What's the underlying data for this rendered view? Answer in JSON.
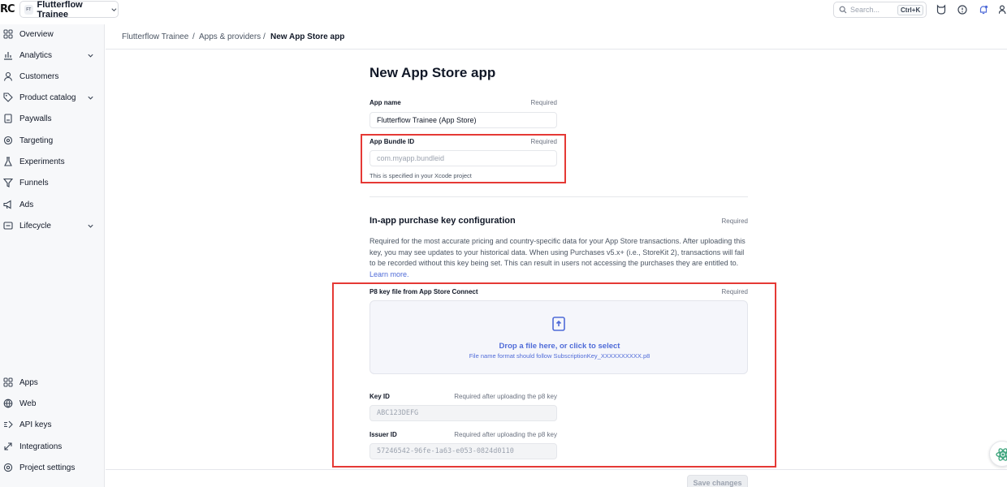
{
  "topbar": {
    "logo_text": "RC",
    "project": {
      "badge": "FT",
      "name": "Flutterflow Trainee"
    },
    "search": {
      "placeholder": "Search...",
      "shortcut": "Ctrl+K"
    },
    "icons": [
      "search-icon",
      "cat-icon",
      "help-icon",
      "notification-icon",
      "user-icon"
    ]
  },
  "sidebar": {
    "top_items": [
      {
        "label": "Overview",
        "icon": "grid-icon",
        "has_chevron": false
      },
      {
        "label": "Analytics",
        "icon": "bar-chart-icon",
        "has_chevron": true
      },
      {
        "label": "Customers",
        "icon": "person-icon",
        "has_chevron": false
      },
      {
        "label": "Product catalog",
        "icon": "tag-icon",
        "has_chevron": true
      },
      {
        "label": "Paywalls",
        "icon": "paywall-icon",
        "has_chevron": false
      },
      {
        "label": "Targeting",
        "icon": "target-icon",
        "has_chevron": false
      },
      {
        "label": "Experiments",
        "icon": "flask-icon",
        "has_chevron": false
      },
      {
        "label": "Funnels",
        "icon": "funnel-icon",
        "has_chevron": false
      },
      {
        "label": "Ads",
        "icon": "megaphone-icon",
        "has_chevron": false
      },
      {
        "label": "Lifecycle",
        "icon": "lifecycle-icon",
        "has_chevron": true
      }
    ],
    "bottom_items": [
      {
        "label": "Apps",
        "icon": "apps-icon"
      },
      {
        "label": "Web",
        "icon": "globe-icon"
      },
      {
        "label": "API keys",
        "icon": "key-icon"
      },
      {
        "label": "Integrations",
        "icon": "integrations-icon"
      },
      {
        "label": "Project settings",
        "icon": "settings-icon"
      }
    ]
  },
  "breadcrumb": {
    "items": [
      "Flutterflow Trainee",
      "Apps & providers",
      "New App Store app"
    ],
    "separator": "/"
  },
  "form": {
    "title": "New App Store app",
    "app_name": {
      "label": "App name",
      "required": "Required",
      "value": "Flutterflow Trainee (App Store)"
    },
    "bundle_id": {
      "label": "App Bundle ID",
      "required": "Required",
      "placeholder": "com.myapp.bundleid",
      "help": "This is specified in your Xcode project"
    },
    "iap_section": {
      "title": "In-app purchase key configuration",
      "required": "Required",
      "description": "Required for the most accurate pricing and country-specific data for your App Store transactions. After uploading this key, you may see updates to your historical data. When using Purchases v5.x+ (i.e., StoreKit 2), transactions will fail to be recorded without this key being set. This can result in users not accessing the purchases they are entitled to.",
      "learn_more": "Learn more."
    },
    "p8": {
      "label": "P8 key file from App Store Connect",
      "required": "Required",
      "drop_text": "Drop a file here, or click to select",
      "format_hint": "File name format should follow SubscriptionKey_XXXXXXXXXX.p8"
    },
    "key_id": {
      "label": "Key ID",
      "note": "Required after uploading the p8 key",
      "placeholder": "ABC123DEFG"
    },
    "issuer_id": {
      "label": "Issuer ID",
      "note": "Required after uploading the p8 key",
      "placeholder": "57246542-96fe-1a63-e053-0824d0110"
    },
    "save_label": "Save changes"
  },
  "colors": {
    "accent": "#4f6bd8",
    "annotation_red": "#e53935",
    "sidebar_bg": "#f7f8fa",
    "dropzone_bg": "#f5f6fb"
  }
}
